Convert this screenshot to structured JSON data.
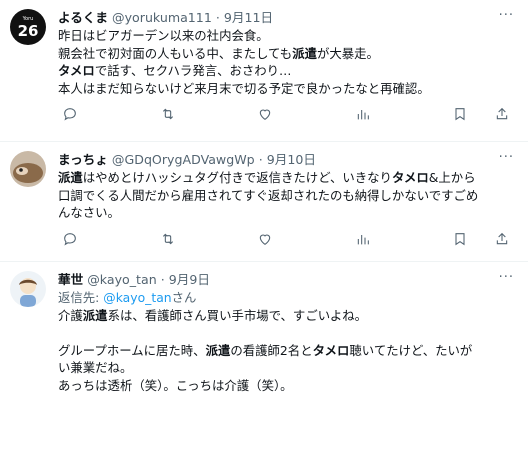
{
  "tweets": [
    {
      "avatar_text": "26",
      "avatar_small": "Yoru",
      "name": "よるくま",
      "handle": "@yorukuma111",
      "dot": "·",
      "date": "9月11日",
      "lines": [
        [
          {
            "t": "昨日はビアガーデン以来の社内会食。"
          }
        ],
        [
          {
            "t": "親会社で初対面の人もいる中、またしても"
          },
          {
            "t": "派遣",
            "b": true
          },
          {
            "t": "が大暴走。"
          }
        ],
        [
          {
            "t": "タメロ",
            "b": true
          },
          {
            "t": "で話す、セクハラ発言、おさわり…"
          }
        ],
        [
          {
            "t": "本人はまだ知らないけど来月末で切る予定で良かったなと再確認。"
          }
        ]
      ]
    },
    {
      "name": "まっちょ",
      "handle": "@GDqOrygADVawgWp",
      "dot": "·",
      "date": "9月10日",
      "lines": [
        [
          {
            "t": "派遣",
            "b": true
          },
          {
            "t": "はやめとけハッシュタグ付きで返信きたけど、いきなり"
          },
          {
            "t": "タメロ",
            "b": true
          },
          {
            "t": "&上から"
          }
        ],
        [
          {
            "t": "口調でくる人間だから雇用されてすぐ返却されたのも納得しかないですごめ"
          }
        ],
        [
          {
            "t": "んなさい。"
          }
        ]
      ]
    },
    {
      "name": "華世",
      "handle": "@kayo_tan",
      "dot": "·",
      "date": "9月9日",
      "reply_prefix": "返信先: ",
      "reply_mention": "@kayo_tan",
      "reply_suffix": "さん",
      "lines": [
        [
          {
            "t": "介護"
          },
          {
            "t": "派遣",
            "b": true
          },
          {
            "t": "系は、看護師さん買い手市場で、すごいよね。"
          }
        ],
        [],
        [
          {
            "t": "グループホームに居た時、"
          },
          {
            "t": "派遣",
            "b": true
          },
          {
            "t": "の看護師2名と"
          },
          {
            "t": "タメロ",
            "b": true
          },
          {
            "t": "聴いてたけど、たいが"
          }
        ],
        [
          {
            "t": "い兼業だね。"
          }
        ],
        [
          {
            "t": "あっちは透析（笑）。こっちは介護（笑）。"
          }
        ]
      ]
    }
  ],
  "more_icon": "more-dots-icon",
  "colors": {
    "text": "#0f1419",
    "secondary": "#536471",
    "link": "#1d9bf0",
    "border": "#eff3f4"
  }
}
